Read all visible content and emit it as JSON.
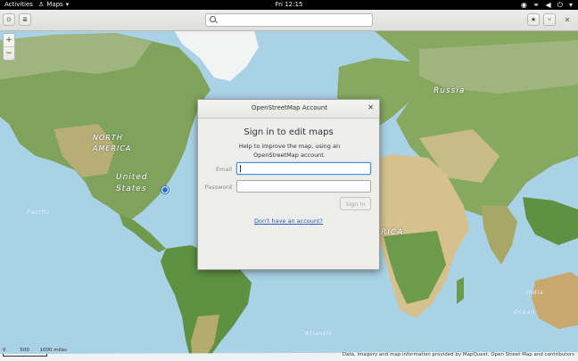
{
  "topbar": {
    "activities": "Activities",
    "app_name": "Maps",
    "clock": "Fri 12:15"
  },
  "header": {
    "search": {
      "placeholder": "",
      "value": ""
    }
  },
  "map": {
    "labels": {
      "north_america": "NORTH\nAMERICA",
      "united_states": "United\nStates",
      "russia": "Russia",
      "africa": "RICA",
      "india": "India",
      "ocean": "Ocean",
      "atlantic": "Atlantic",
      "pacific": "Pacific"
    },
    "scale": {
      "km": "500",
      "miles": "1000 miles",
      "zero": "0"
    },
    "attribution": "Data, imagery and map information provided by MapQuest, Open Street Map and contributors"
  },
  "zoom": {
    "in": "+",
    "out": "−"
  },
  "dialog": {
    "title": "OpenStreetMap Account",
    "heading": "Sign in to edit maps",
    "description": "Help to improve the map, using an OpenStreetMap account.",
    "email_label": "Email",
    "email_value": "",
    "password_label": "Password",
    "password_value": "",
    "signin_label": "Sign In",
    "no_account_link": "Don't have an account?"
  },
  "colors": {
    "topbar_bg": "#000000",
    "ocean": "#a9d2e6",
    "land_green": "#7fa35a",
    "desert": "#d9c594",
    "ice": "#f4f6f6",
    "link": "#2a5db0",
    "focus": "#4a90d9"
  }
}
